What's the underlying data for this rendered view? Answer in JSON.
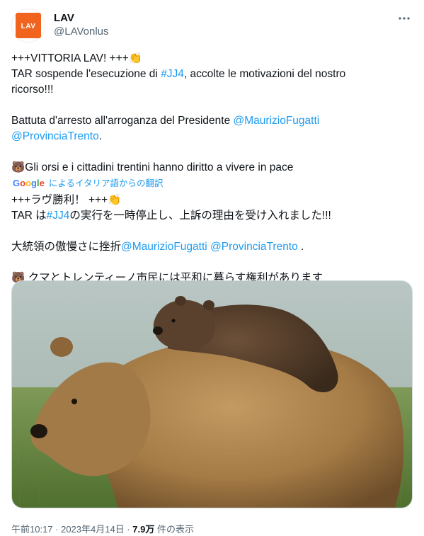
{
  "author": {
    "display_name": "LAV",
    "handle": "@LAVonlus",
    "logo_text": "LAV",
    "brand_color": "#f0641e"
  },
  "more_icon": "more-horizontal-icon",
  "tweet": {
    "l1": "+++VITTORIA LAV! +++👏",
    "l2_a": "TAR sospende l'esecuzione di ",
    "l2_tag": "#JJ4",
    "l2_b": ", accolte le motivazioni del nostro",
    "l3": "ricorso!!!",
    "l4_a": "Battuta d'arresto all'arroganza del Presidente ",
    "l4_mention": "@MaurizioFugatti",
    "l5_mention": "@ProvinciaTrento",
    "l5_b": ".",
    "l6": "🐻Gli orsi e i cittadini trentini hanno diritto a vivere in pace"
  },
  "translation": {
    "provider": "Google",
    "label": "によるイタリア語からの翻訳",
    "l1": "+++ラヴ勝利！ +++👏",
    "l2_a": "TAR は",
    "l2_tag": "#JJ4",
    "l2_b": "の実行を一時停止し、上訴の理由を受け入れました!!!",
    "l3_a": "大統領の傲慢さに挫折",
    "l3_mention1": "@MaurizioFugatti",
    "l3_sp": " ",
    "l3_mention2": "@ProvinciaTrento",
    "l3_b": " .",
    "l4": "🐻 クマとトレンティーノ市民には平和に暮らす権利があります"
  },
  "media": {
    "alt": "bear-photo"
  },
  "footer": {
    "time": "午前10:17 · 2023年4月14日 · ",
    "views_count": "7.9万",
    "views_label": " 件の表示"
  }
}
